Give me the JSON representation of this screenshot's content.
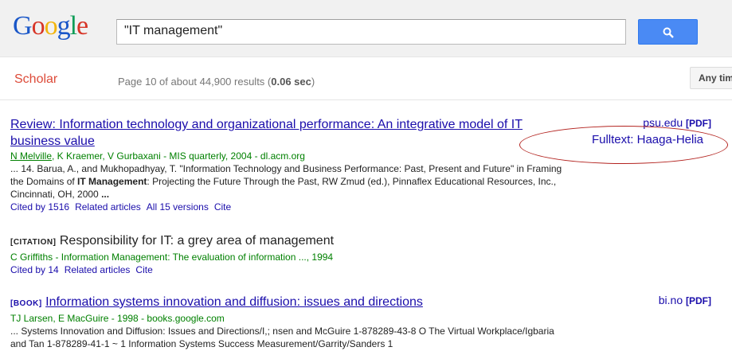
{
  "logo": {
    "letters": [
      "G",
      "o",
      "o",
      "g",
      "l",
      "e"
    ]
  },
  "search": {
    "query": "\"IT management\""
  },
  "subbar": {
    "scholar_label": "Scholar",
    "stats_prefix": "Page 10 of about 44,900 results (",
    "stats_time": "0.06 sec",
    "stats_suffix": ")",
    "anytime_label": "Any time"
  },
  "results": [
    {
      "title": "Review: Information technology and organizational performance: An integrative model of IT business value",
      "authors_linked": "N Melville",
      "authors_rest": ", K Kraemer, V Gurbaxani - MIS quarterly, 2004 - dl.acm.org",
      "snippet_1": "... 14. Barua, A., and Mukhopadhyay, T. \"Information Technology and Business Performance: Past, Present and Future\" in Framing the Domains of ",
      "snippet_bold": "IT Management",
      "snippet_2": ": Projecting the Future Through the Past, RW Zmud (ed.), Pinnaflex Educational Resources, Inc., Cincinnati, OH, 2000 ",
      "snippet_end": "...",
      "cited_by": "Cited by 1516",
      "related": "Related articles",
      "versions": "All 15 versions",
      "cite": "Cite",
      "side_source": "psu.edu",
      "side_pdf": "[PDF]",
      "side_fulltext": "Fulltext: Haaga-Helia"
    },
    {
      "tag": "[CITATION]",
      "title": "Responsibility for IT: a grey area of management",
      "authors": "C Griffiths - Information Management: The evaluation of information ..., 1994",
      "cited_by": "Cited by 14",
      "related": "Related articles",
      "cite": "Cite"
    },
    {
      "tag": "[BOOK]",
      "title": "Information systems innovation and diffusion: issues and directions",
      "authors": "TJ Larsen, E MacGuire - 1998 - books.google.com",
      "snippet_1": "... Systems Innovation and Diffusion: Issues and Directions/I,; nsen and McGuire 1-878289-43-8 O The Virtual Workplace/Igbaria and Tan 1-878289-41-1 ~ 1 Information Systems Success Measurement/Garrity/Sanders 1",
      "side_source": "bi.no",
      "side_pdf": "[PDF]"
    }
  ],
  "colors": {
    "link": "#1a0dab",
    "author_green": "#008000",
    "scholar_red": "#dd4b39",
    "search_button": "#4a8af4",
    "annotation_ellipse": "#b3231f"
  },
  "icons": {
    "search_button_icon": "search-icon"
  }
}
